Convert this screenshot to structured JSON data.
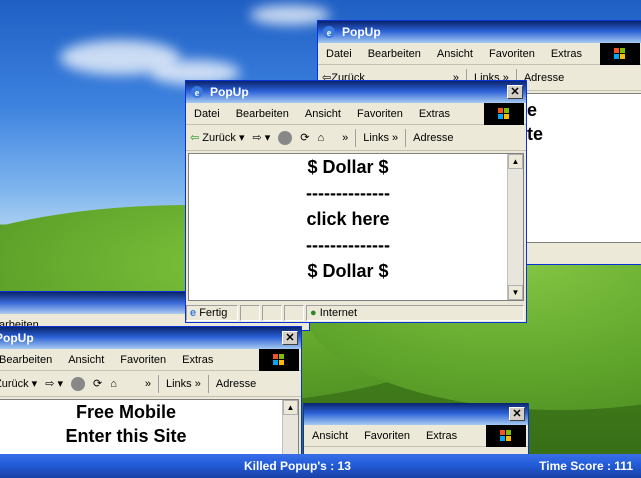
{
  "windows": {
    "title": "PopUp",
    "menu": [
      "Datei",
      "Bearbeiten",
      "Ansicht",
      "Favoriten",
      "Extras"
    ],
    "toolbar": {
      "back": "Zurück",
      "links": "Links",
      "address": "Adresse",
      "chevron": "»"
    },
    "close": "✕"
  },
  "back_window": {
    "lines": [
      "e",
      "te"
    ]
  },
  "main_window": {
    "lines": [
      "$ Dollar $",
      "--------------",
      "click here",
      "--------------",
      "$ Dollar $"
    ],
    "status": {
      "left": "Fertig",
      "zone": "Internet"
    }
  },
  "left_window": {
    "lines": [
      "Free Mobile",
      "Enter this Site"
    ],
    "partial_menu": "arbeiten"
  },
  "bottom_window": {
    "menu": [
      "Ansicht",
      "Favoriten",
      "Extras"
    ]
  },
  "hud": {
    "killed": "Killed Popup's : 13",
    "score": "Time Score : 111"
  }
}
